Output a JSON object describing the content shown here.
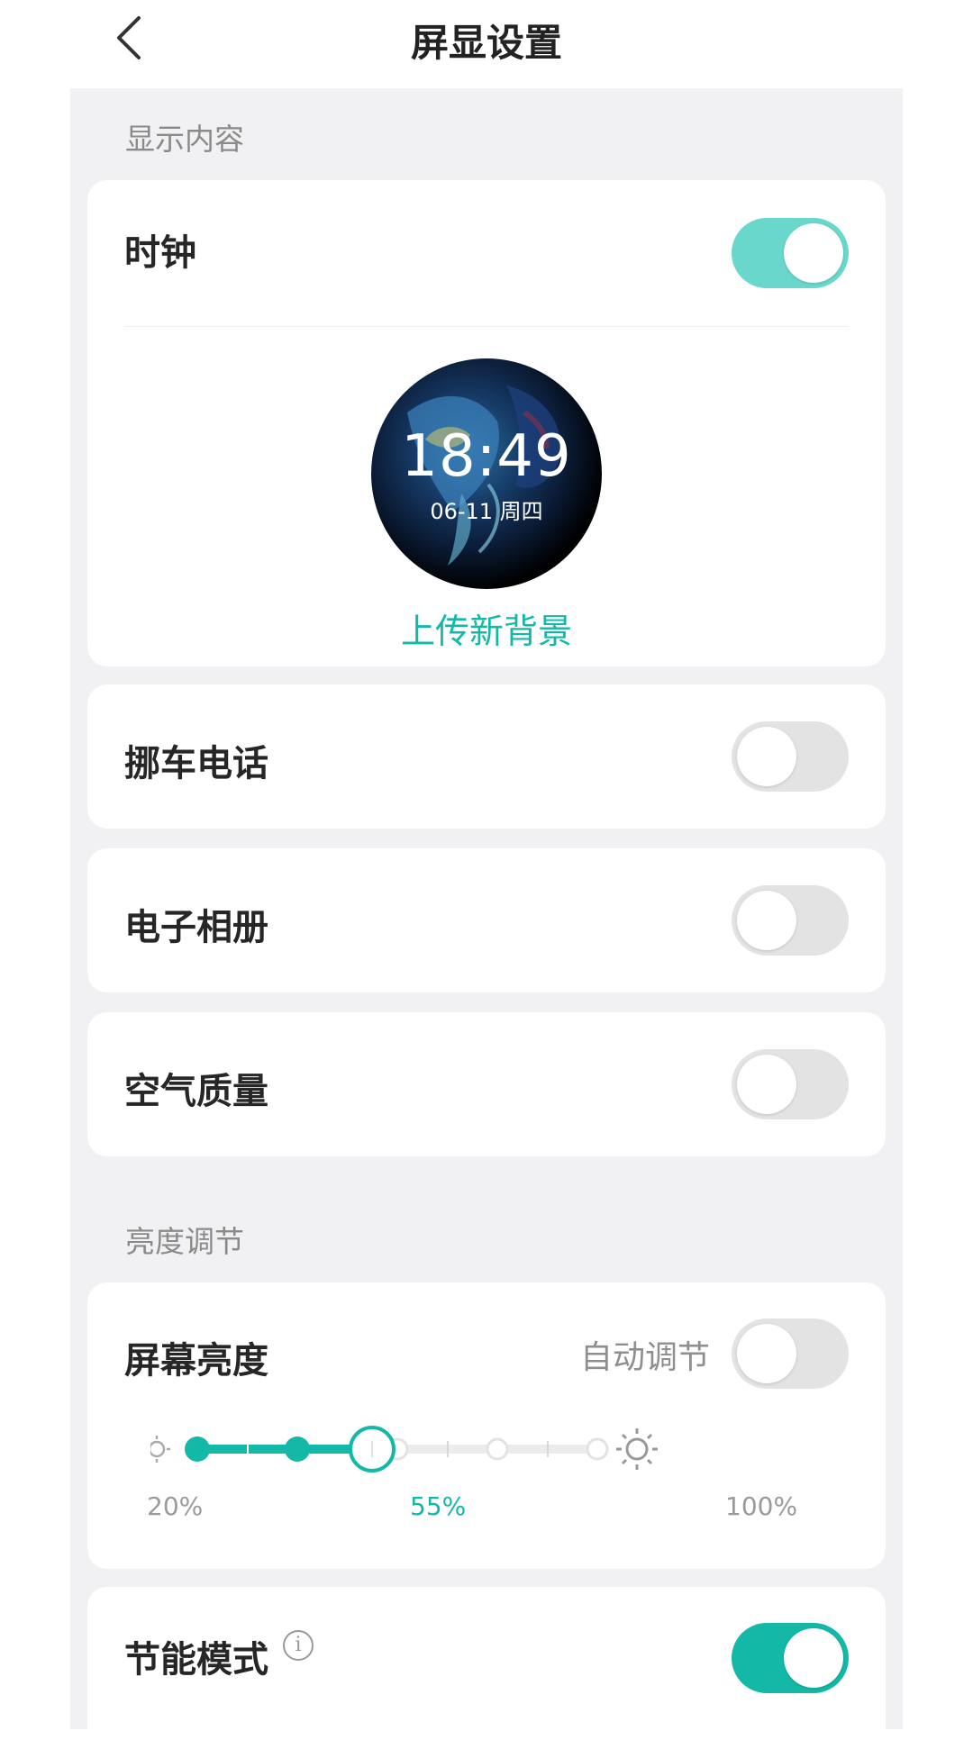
{
  "header": {
    "title": "屏显设置"
  },
  "display_section": {
    "label": "显示内容",
    "clock": {
      "label": "时钟",
      "enabled": true,
      "preview_time": "18:49",
      "preview_date": "06-11 周四",
      "upload_label": "上传新背景"
    },
    "move_car_phone": {
      "label": "挪车电话",
      "enabled": false
    },
    "photo_album": {
      "label": "电子相册",
      "enabled": false
    },
    "air_quality": {
      "label": "空气质量",
      "enabled": false
    }
  },
  "brightness_section": {
    "label": "亮度调节",
    "screen_brightness": {
      "label": "屏幕亮度",
      "auto_label": "自动调节",
      "auto_enabled": false,
      "value_percent": 55,
      "min_label": "20%",
      "current_label": "55%",
      "max_label": "100%"
    }
  },
  "power_saving": {
    "label": "节能模式",
    "enabled": true
  },
  "colors": {
    "accent": "#14b8a6",
    "toggle_on_light": "#6ad7cd",
    "toggle_off": "#e3e3e3",
    "background": "#f1f1f3"
  }
}
